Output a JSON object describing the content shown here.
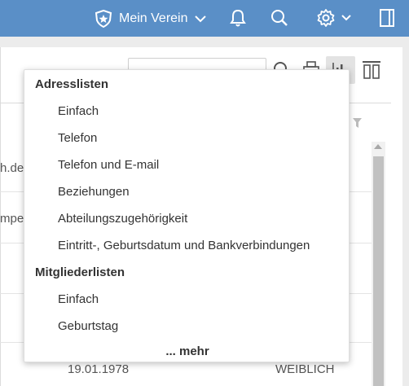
{
  "topbar": {
    "club_label": "Mein Verein",
    "icons": [
      "star-shield-icon",
      "chevron-down-icon",
      "bell-icon",
      "search-icon",
      "gear-icon",
      "chevron-down-icon",
      "sidebar-toggle-icon"
    ]
  },
  "toolbar": {
    "search_value": "",
    "icons": [
      "search-icon",
      "print-icon",
      "chart-icon",
      "columns-icon"
    ]
  },
  "table": {
    "rows": [
      {
        "email": "h.de",
        "date": "",
        "gender": ""
      },
      {
        "email": "mpel",
        "date": "",
        "gender": ""
      },
      {
        "email": "",
        "date": "19.01.1978",
        "gender": "WEIBLICH"
      }
    ]
  },
  "menu": {
    "sections": [
      {
        "title": "Adresslisten",
        "items": [
          "Einfach",
          "Telefon",
          "Telefon und E-mail",
          "Beziehungen",
          "Abteilungszugehörigkeit",
          "Eintritt-, Geburtsdatum und Bankverbindungen"
        ]
      },
      {
        "title": "Mitgliederlisten",
        "items": [
          "Einfach",
          "Geburtstag"
        ]
      }
    ],
    "more_label": "... mehr"
  },
  "colors": {
    "topbar": "#5a8fc7",
    "menu_bg": "#ffffff",
    "text": "#333333"
  }
}
